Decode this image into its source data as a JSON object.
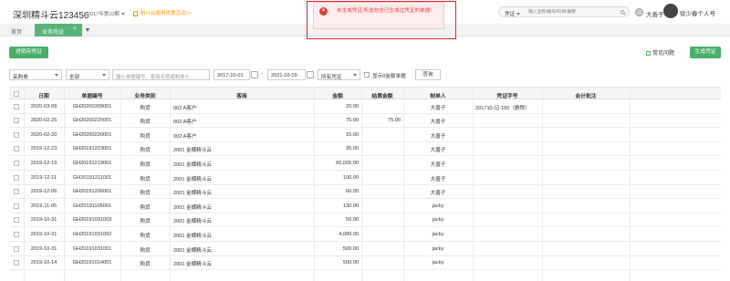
{
  "header": {
    "company": "深圳精斗云123456",
    "period": "2017年第10期",
    "promo": "精斗云使用优惠活动>>",
    "search_type": "凭证",
    "search_placeholder": "输入全称/编号/科目/摘要",
    "user_name": "大善子",
    "account_name": "徐少春个人号"
  },
  "tabs": {
    "home": "首页",
    "active": "业务凭证",
    "close": "×"
  },
  "toolbar": {
    "generate_draft": "进销存凭证",
    "faq": "常见问题",
    "generate": "生成凭证"
  },
  "filters": {
    "doc_type": "采购单",
    "scope": "全部",
    "keyword_placeholder": "输入单据编号、客商名称或制单人",
    "date_from": "2017-10-01",
    "date_to": "2021-10-19",
    "voucher_status": "所有凭证",
    "show_zero": "显示0金额单据",
    "query": "查询"
  },
  "toast": {
    "message": "未生成凭证,所选包含已生成过凭证的单据!",
    "icon": "×"
  },
  "table": {
    "headers": [
      "日期",
      "单据编号",
      "业务类别",
      "客商",
      "金额",
      "结算金额",
      "制单人",
      "凭证字号",
      "会计批注"
    ],
    "rows": [
      [
        "2020-03-09",
        "GH20200309001",
        "购货",
        "002 A客户",
        "20.00",
        "",
        "大善子",
        "201710-记-155（删除）",
        ""
      ],
      [
        "2020-02-25",
        "GH20200225001",
        "购货",
        "002 A客户",
        "75.00",
        "75.00",
        "大善子",
        "",
        ""
      ],
      [
        "2020-02-20",
        "GH20200220001",
        "购货",
        "002 A客户",
        "15.00",
        "",
        "大善子",
        "",
        ""
      ],
      [
        "2019-12-23",
        "GH20191223001",
        "购货",
        "2001 金蝶精斗云",
        "35.00",
        "",
        "大善子",
        "",
        ""
      ],
      [
        "2019-12-19",
        "GH20191219001",
        "购货",
        "2001 金蝶精斗云",
        "60,005.00",
        "",
        "大善子",
        "",
        ""
      ],
      [
        "2019-12-11",
        "GH20191211001",
        "购货",
        "2001 金蝶精斗云",
        "100.00",
        "",
        "大善子",
        "",
        ""
      ],
      [
        "2019-12-06",
        "GH20191206001",
        "购货",
        "2001 金蝶精斗云",
        "60.00",
        "",
        "大善子",
        "",
        ""
      ],
      [
        "2019-11-05",
        "GH20191105001",
        "购货",
        "2001 金蝶精斗云",
        "130.00",
        "",
        "jacky",
        "",
        ""
      ],
      [
        "2019-10-31",
        "GH20191031003",
        "购货",
        "2001 金蝶精斗云",
        "50.00",
        "",
        "jacky",
        "",
        ""
      ],
      [
        "2019-10-31",
        "GH20191031002",
        "购货",
        "2001 金蝶精斗云",
        "4,000.00",
        "",
        "jacky",
        "",
        ""
      ],
      [
        "2019-10-31",
        "GH20191031001",
        "购货",
        "2001 金蝶精斗云",
        "500.00",
        "",
        "jacky",
        "",
        ""
      ],
      [
        "2019-10-14",
        "GH20191014001",
        "购货",
        "2001 金蝶精斗云",
        "500.00",
        "",
        "jacky",
        "",
        ""
      ]
    ]
  },
  "colors": {
    "accent": "#4caf6b",
    "tab_active": "#5ab27a",
    "error": "#e4393c",
    "promo": "#f39800"
  },
  "icons": [
    "search-icon",
    "bell-icon",
    "calendar-icon",
    "error-icon",
    "close-icon",
    "chevron-down-icon",
    "help-icon"
  ]
}
